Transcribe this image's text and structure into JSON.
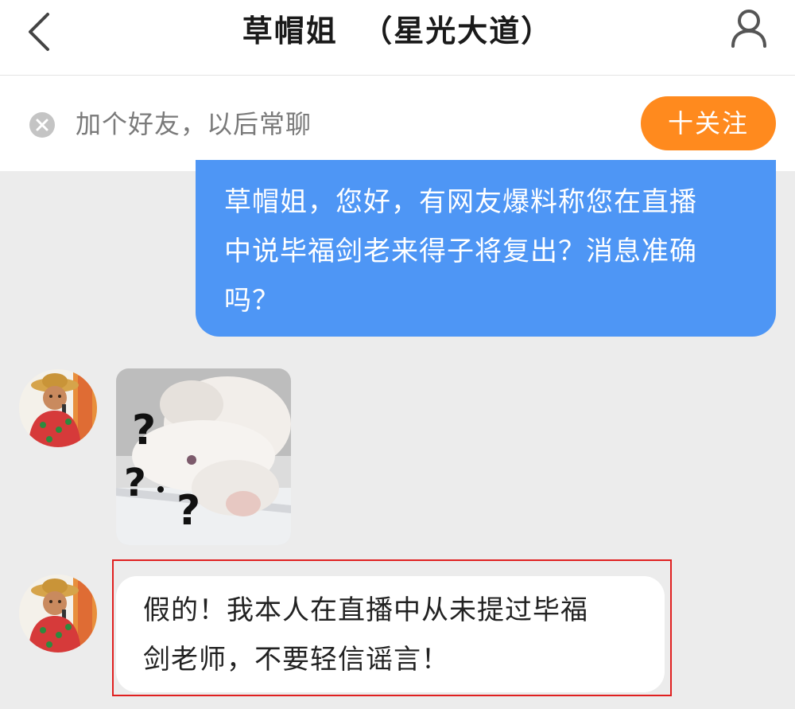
{
  "header": {
    "back_icon": "chevron-left-icon",
    "title": "草帽姐  （星光大道）",
    "profile_icon": "person-icon"
  },
  "follow_bar": {
    "dismiss_icon": "close-circle-icon",
    "tip": "加个好友，以后常聊",
    "follow_label": "十关注",
    "follow_color": "#ff8a1e"
  },
  "messages": [
    {
      "direction": "outgoing",
      "type": "text",
      "lines": [
        "草帽姐，您好，有网友爆料称您在直播",
        "中说毕福剑老来得子将复出？消息准确",
        "吗？"
      ],
      "bubble_color": "#4e96f5"
    },
    {
      "direction": "incoming",
      "type": "sticker",
      "sticker_icon": "confused-cat-sticker",
      "glyphs": [
        "?",
        "?",
        "?"
      ]
    },
    {
      "direction": "incoming",
      "type": "text",
      "lines": [
        "假的！我本人在直播中从未提过毕福",
        "剑老师，不要轻信谣言！"
      ],
      "highlight_color": "#e02020"
    }
  ]
}
